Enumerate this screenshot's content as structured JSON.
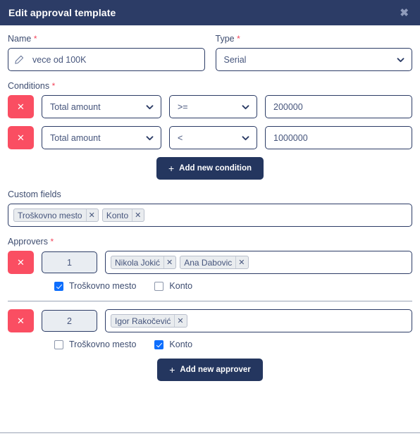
{
  "header": {
    "title": "Edit approval template",
    "close_label": "✖"
  },
  "form": {
    "name": {
      "label": "Name",
      "required_mark": "*",
      "value": "vece od 100K",
      "icon": "pencil-icon"
    },
    "type": {
      "label": "Type",
      "required_mark": "*",
      "value": "Serial",
      "options": [
        "Serial"
      ]
    },
    "conditions": {
      "label": "Conditions",
      "required_mark": "*",
      "delete_label": "✕",
      "rows": [
        {
          "field": "Total amount",
          "operator": ">=",
          "value": "200000"
        },
        {
          "field": "Total amount",
          "operator": "<",
          "value": "1000000"
        }
      ],
      "field_options": [
        "Total amount"
      ],
      "operator_options": [
        ">=",
        "<"
      ],
      "add_button": "Add new condition",
      "add_icon": "+"
    },
    "custom_fields": {
      "label": "Custom fields",
      "tags": [
        "Troškovno mesto",
        "Konto"
      ],
      "tag_remove_label": "✕"
    },
    "approvers": {
      "label": "Approvers",
      "required_mark": "*",
      "delete_label": "✕",
      "tag_remove_label": "✕",
      "rows": [
        {
          "order": "1",
          "tags": [
            "Nikola Jokić",
            "Ana Dabovic"
          ],
          "checkboxes": [
            {
              "label": "Troškovno mesto",
              "checked": true
            },
            {
              "label": "Konto",
              "checked": false
            }
          ]
        },
        {
          "order": "2",
          "tags": [
            "Igor Rakočević"
          ],
          "checkboxes": [
            {
              "label": "Troškovno mesto",
              "checked": false
            },
            {
              "label": "Konto",
              "checked": true
            }
          ]
        }
      ],
      "add_button": "Add new approver",
      "add_icon": "+"
    }
  },
  "colors": {
    "header_bg": "#2c3c66",
    "primary": "#24365f",
    "danger": "#fa4e62",
    "required": "#f3455b",
    "checkbox_checked": "#0d6efd",
    "border": "#2c3c66",
    "text": "#46557c"
  }
}
